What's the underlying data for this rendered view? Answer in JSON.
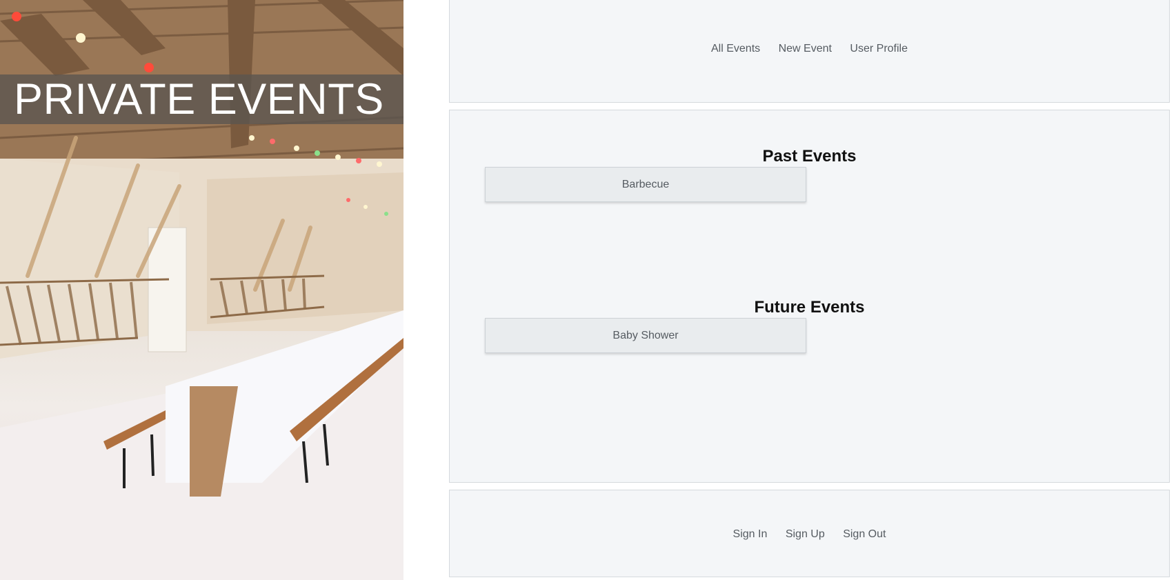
{
  "hero": {
    "title": "PRIVATE EVENTS",
    "image": "banquet-hall-photo"
  },
  "top_nav": {
    "items": [
      "All Events",
      "New Event",
      "User Profile"
    ]
  },
  "main": {
    "past_heading": "Past Events",
    "past_events": [
      "Barbecue"
    ],
    "future_heading": "Future Events",
    "future_events": [
      "Baby Shower"
    ]
  },
  "bottom_nav": {
    "items": [
      "Sign In",
      "Sign Up",
      "Sign Out"
    ]
  },
  "colors": {
    "panel_bg": "#f4f6f8",
    "card_bg": "#e9ecee",
    "link_text": "#555b61",
    "heading_text": "#111111"
  }
}
